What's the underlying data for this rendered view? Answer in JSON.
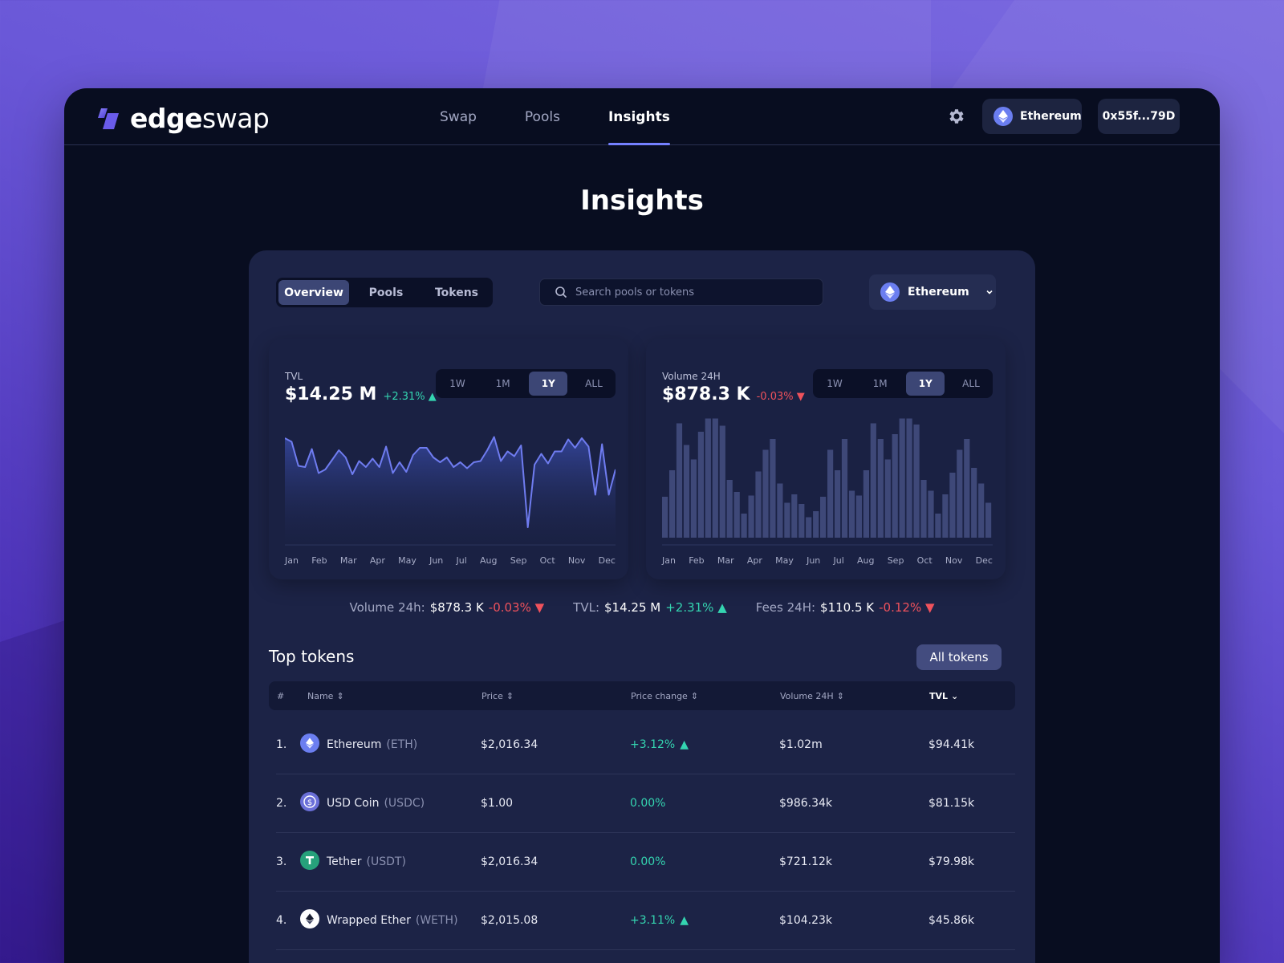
{
  "app": {
    "logo_bold": "edge",
    "logo_light": "swap"
  },
  "nav": {
    "items": [
      {
        "label": "Swap",
        "active": false
      },
      {
        "label": "Pools",
        "active": false
      },
      {
        "label": "Insights",
        "active": true
      }
    ]
  },
  "header": {
    "network": "Ethereum",
    "address": "0x55f...79D",
    "settings_icon": "gear-icon"
  },
  "page": {
    "title": "Insights"
  },
  "tabs": [
    {
      "label": "Overview",
      "active": true
    },
    {
      "label": "Pools",
      "active": false
    },
    {
      "label": "Tokens",
      "active": false
    }
  ],
  "search": {
    "placeholder": "Search pools or tokens"
  },
  "chain_select": {
    "value": "Ethereum"
  },
  "ranges": [
    "1W",
    "1M",
    "1Y",
    "ALL"
  ],
  "tvl_card": {
    "label": "TVL",
    "value": "$14.25 M",
    "change": "+2.31%",
    "direction": "up",
    "active_range": "1Y"
  },
  "volume_card": {
    "label": "Volume 24H",
    "value": "$878.3 K",
    "change": "-0.03%",
    "direction": "down",
    "active_range": "1Y"
  },
  "months": [
    "Jan",
    "Feb",
    "Mar",
    "Apr",
    "May",
    "Jun",
    "Jul",
    "Aug",
    "Sep",
    "Oct",
    "Nov",
    "Dec"
  ],
  "chart_data": [
    {
      "type": "area",
      "title": "TVL",
      "x_labels": [
        "Jan",
        "Feb",
        "Mar",
        "Apr",
        "May",
        "Jun",
        "Jul",
        "Aug",
        "Sep",
        "Oct",
        "Nov",
        "Dec"
      ],
      "values": [
        0.86,
        0.83,
        0.63,
        0.62,
        0.77,
        0.57,
        0.6,
        0.68,
        0.76,
        0.7,
        0.56,
        0.67,
        0.62,
        0.69,
        0.62,
        0.79,
        0.57,
        0.66,
        0.58,
        0.72,
        0.78,
        0.78,
        0.7,
        0.66,
        0.7,
        0.62,
        0.66,
        0.61,
        0.66,
        0.67,
        0.76,
        0.87,
        0.67,
        0.75,
        0.71,
        0.8,
        0.12,
        0.64,
        0.73,
        0.65,
        0.75,
        0.75,
        0.85,
        0.78,
        0.86,
        0.79,
        0.39,
        0.81,
        0.39,
        0.6
      ],
      "grid": false
    },
    {
      "type": "bar",
      "title": "Volume 24H",
      "x_labels": [
        "Jan",
        "Feb",
        "Mar",
        "Apr",
        "May",
        "Jun",
        "Jul",
        "Aug",
        "Sep",
        "Oct",
        "Nov",
        "Dec"
      ],
      "values": [
        0.34,
        0.56,
        0.95,
        0.77,
        0.65,
        0.88,
        0.99,
        0.99,
        0.93,
        0.48,
        0.38,
        0.2,
        0.35,
        0.55,
        0.73,
        0.82,
        0.45,
        0.29,
        0.36,
        0.28,
        0.17,
        0.22,
        0.34,
        0.73,
        0.56,
        0.82,
        0.39,
        0.35,
        0.56,
        0.95,
        0.82,
        0.65,
        0.86,
        0.99,
        0.99,
        0.94,
        0.48,
        0.39,
        0.2,
        0.36,
        0.54,
        0.73,
        0.82,
        0.58,
        0.45,
        0.29
      ],
      "grid": false
    }
  ],
  "summary_stats": [
    {
      "label": "Volume 24h:",
      "value": "$878.3 K",
      "change": "-0.03%",
      "direction": "down"
    },
    {
      "label": "TVL:",
      "value": "$14.25 M",
      "change": "+2.31%",
      "direction": "up"
    },
    {
      "label": "Fees 24H:",
      "value": "$110.5 K",
      "change": "-0.12%",
      "direction": "down"
    }
  ],
  "top_tokens": {
    "title": "Top tokens",
    "all_button": "All tokens",
    "columns": [
      "#",
      "Name",
      "Price",
      "Price change",
      "Volume 24H",
      "TVL"
    ],
    "sorted_column": "TVL",
    "rows": [
      {
        "rank": "1.",
        "name": "Ethereum",
        "symbol": "(ETH)",
        "price": "$2,016.34",
        "change": "+3.12%",
        "change_dir": "up",
        "volume": "$1.02m",
        "tvl": "$94.41k",
        "icon": "eth-icon",
        "icon_color": "#6b7ef0"
      },
      {
        "rank": "2.",
        "name": "USD Coin",
        "symbol": "(USDC)",
        "price": "$1.00",
        "change": "0.00%",
        "change_dir": "flat",
        "volume": "$986.34k",
        "tvl": "$81.15k",
        "icon": "usdc-icon",
        "icon_color": "#6a6fd8"
      },
      {
        "rank": "3.",
        "name": "Tether",
        "symbol": "(USDT)",
        "price": "$2,016.34",
        "change": "0.00%",
        "change_dir": "flat",
        "volume": "$721.12k",
        "tvl": "$79.98k",
        "icon": "tether-icon",
        "icon_color": "#26a17b"
      },
      {
        "rank": "4.",
        "name": "Wrapped Ether",
        "symbol": "(WETH)",
        "price": "$2,015.08",
        "change": "+3.11%",
        "change_dir": "up",
        "volume": "$104.23k",
        "tvl": "$45.86k",
        "icon": "weth-icon",
        "icon_color": "#ffffff"
      }
    ]
  },
  "colors": {
    "accent": "#7480ff",
    "up": "#34d4b0",
    "down": "#f0525c",
    "panel": "#1c2346",
    "chart_line": "#6f7cf0",
    "bar": "#3e4878"
  }
}
